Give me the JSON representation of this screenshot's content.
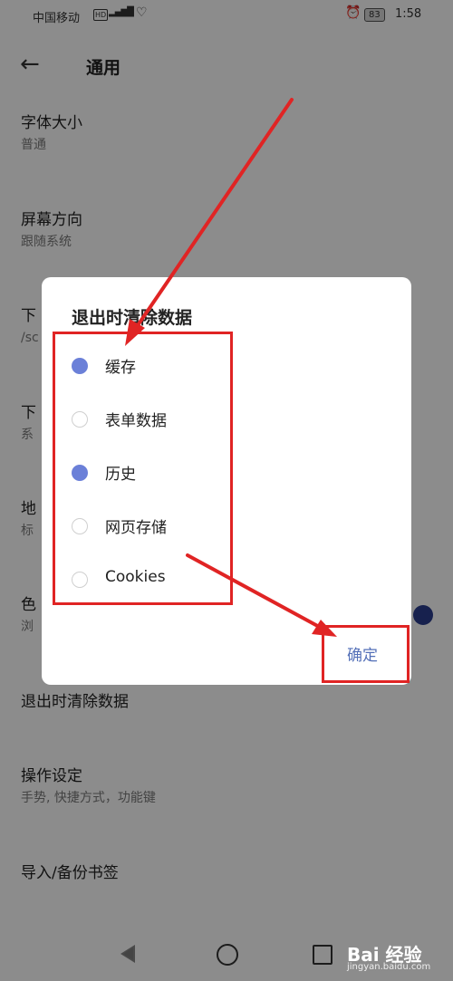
{
  "status_bar": {
    "carrier": "中国移动",
    "hd_badge": "HD",
    "signal": "4G",
    "battery": "83",
    "time": "1:58"
  },
  "header": {
    "back_icon": "arrow-left-icon",
    "title": "通用"
  },
  "settings": [
    {
      "label": "字体大小",
      "sub": "普通"
    },
    {
      "label": "屏幕方向",
      "sub": "跟随系统"
    },
    {
      "label": "下",
      "sub": "/sc"
    },
    {
      "label": "下",
      "sub": "系"
    },
    {
      "label": "地",
      "sub": "标"
    },
    {
      "label": "色",
      "sub": "浏"
    },
    {
      "label": "退出时清除数据",
      "sub": ""
    },
    {
      "label": "操作设定",
      "sub": "手势, 快捷方式，功能键"
    },
    {
      "label": "导入/备份书签",
      "sub": ""
    }
  ],
  "dialog": {
    "title": "退出时清除数据",
    "options": [
      {
        "label": "缓存",
        "checked": true
      },
      {
        "label": "表单数据",
        "checked": false
      },
      {
        "label": "历史",
        "checked": true
      },
      {
        "label": "网页存储",
        "checked": false
      },
      {
        "label": "Cookies",
        "checked": false
      }
    ],
    "confirm": "确定"
  },
  "watermark": {
    "text": "Bai 经验",
    "sub": "jingyan.baidu.com"
  },
  "colors": {
    "accent": "#6b80d8",
    "confirm_text": "#5470b8",
    "annotation": "#e02424",
    "overlay": "rgba(0,0,0,0.45)"
  }
}
